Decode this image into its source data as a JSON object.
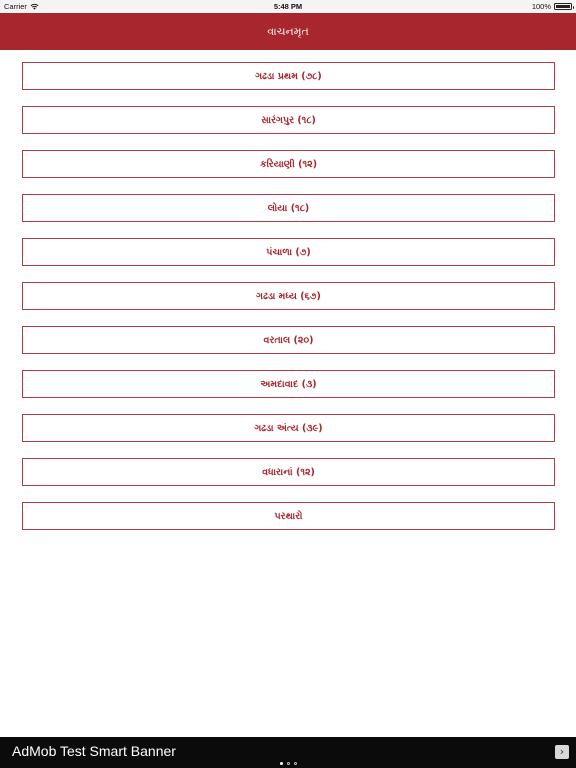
{
  "status_bar": {
    "carrier": "Carrier",
    "time": "5:48 PM",
    "battery": "100%"
  },
  "nav": {
    "title": "વાચનમૃત"
  },
  "menu": {
    "items": [
      {
        "label": "ગઢડા પ્રથમ (૭૮)"
      },
      {
        "label": "સારંગપુર (૧૮)"
      },
      {
        "label": "કરિયાણી (૧૨)"
      },
      {
        "label": "લોયા (૧૮)"
      },
      {
        "label": "પંચાળા (૭)"
      },
      {
        "label": "ગઢડા મધ્ય (૬૭)"
      },
      {
        "label": "વરતાલ (૨૦)"
      },
      {
        "label": "અમદાવાદ (૩)"
      },
      {
        "label": "ગઢડા અંત્ય (૩૯)"
      },
      {
        "label": "વધારાનાં (૧૨)"
      },
      {
        "label": "પરથારો"
      }
    ]
  },
  "ad": {
    "text": "AdMob Test Smart Banner",
    "arrow_icon": "chevron-right-icon"
  },
  "colors": {
    "primary": "#a8262e",
    "border": "#b23a44"
  }
}
